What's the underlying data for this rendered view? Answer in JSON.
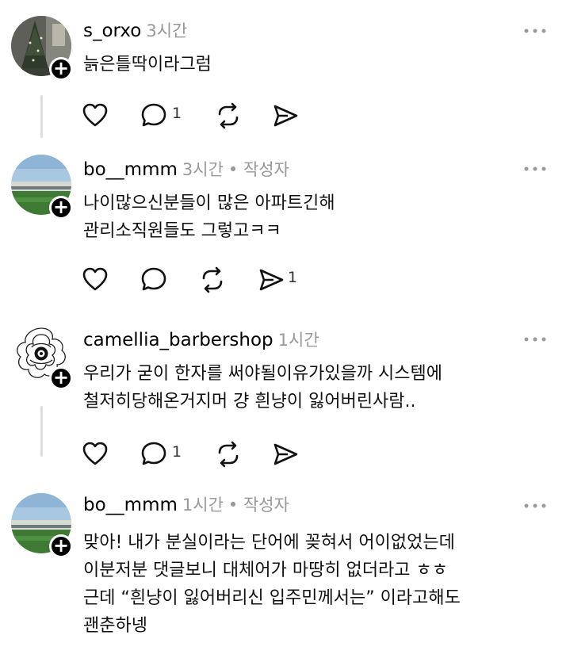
{
  "comments": [
    {
      "username": "s_orxo",
      "time": "3시간",
      "author_tag": "",
      "lines": [
        "늙은틀딱이라그럼"
      ],
      "reply_count": "1",
      "share_count": ""
    },
    {
      "username": "bo__mmm",
      "time": "3시간",
      "author_tag": "• 작성자",
      "lines": [
        "나이많으신분들이 많은 아파트긴해",
        "관리소직원들도 그렇고ㅋㅋ"
      ],
      "reply_count": "",
      "share_count": "1"
    },
    {
      "username": "camellia_barbershop",
      "time": "1시간",
      "author_tag": "",
      "lines": [
        "우리가 굳이 한자를 써야될이유가있을까 시스템에",
        "철저히당해온거지머 걍 흰냥이 잃어버린사람.."
      ],
      "reply_count": "1",
      "share_count": ""
    },
    {
      "username": "bo__mmm",
      "time": "1시간",
      "author_tag": "• 작성자",
      "lines": [
        "맞아! 내가 분실이라는 단어에 꽂혀서 어이없었는데",
        "이분저분 댓글보니 대체어가 마땅히 없더라고 ㅎㅎ",
        "근데 “흰냥이 잃어버리신 입주민께서는” 이라고해도",
        "괜춘하넹"
      ],
      "reply_count": "",
      "share_count": ""
    }
  ],
  "icons": {
    "like": "heart-icon",
    "reply": "comment-icon",
    "repost": "repost-icon",
    "share": "send-icon",
    "more": "more-options-icon",
    "follow": "plus-icon"
  },
  "plus_glyph": "+"
}
